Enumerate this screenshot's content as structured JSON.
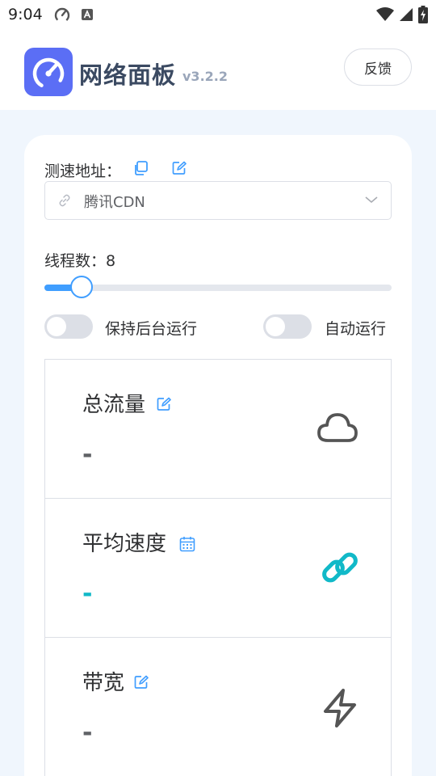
{
  "status_bar": {
    "time": "9:04"
  },
  "header": {
    "app_name": "网络面板",
    "version": "v3.2.2",
    "feedback_label": "反馈",
    "accent": "#5b6ef5"
  },
  "speed_test": {
    "url_label": "测速地址：",
    "selected_server": "腾讯CDN"
  },
  "threads": {
    "label": "线程数：8",
    "value": 8,
    "slider_fraction": 0.107
  },
  "toggles": {
    "keep_background": {
      "label": "保持后台运行",
      "on": false
    },
    "auto_run": {
      "label": "自动运行",
      "on": false
    }
  },
  "stats": [
    {
      "title": "总流量",
      "value": "-",
      "value_color": "#606266",
      "icon": "cloud-icon",
      "title_icon": "edit-icon"
    },
    {
      "title": "平均速度",
      "value": "-",
      "value_color": "#11b9c8",
      "icon": "link-icon",
      "title_icon": "calendar-icon"
    },
    {
      "title": "带宽",
      "value": "-",
      "value_color": "#606266",
      "icon": "lightning-icon",
      "title_icon": "edit-icon"
    }
  ],
  "colors": {
    "primary": "#409eff",
    "teal": "#11b9c8",
    "page_bg": "#f0f6fd"
  }
}
